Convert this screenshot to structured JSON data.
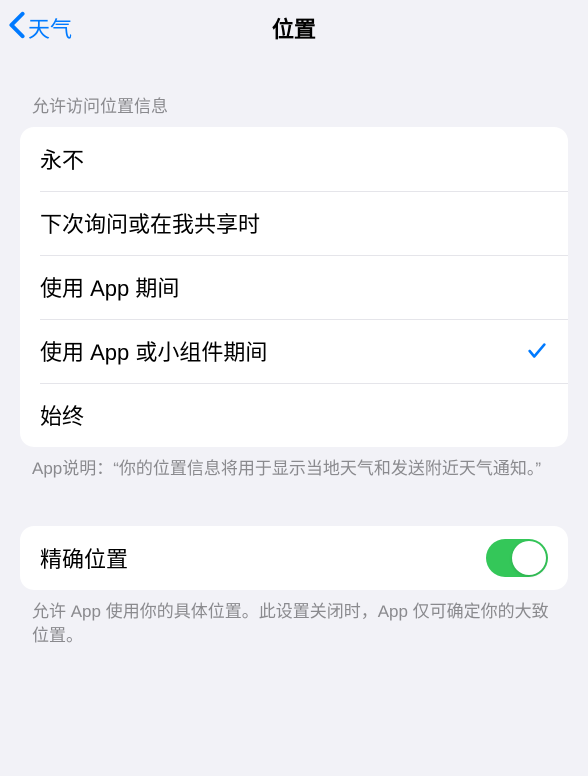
{
  "nav": {
    "back_label": "天气",
    "title": "位置"
  },
  "section1": {
    "header": "允许访问位置信息",
    "options": [
      {
        "label": "永不",
        "selected": false
      },
      {
        "label": "下次询问或在我共享时",
        "selected": false
      },
      {
        "label": "使用 App 期间",
        "selected": false
      },
      {
        "label": "使用 App 或小组件期间",
        "selected": true
      },
      {
        "label": "始终",
        "selected": false
      }
    ],
    "footer": "App说明：“你的位置信息将用于显示当地天气和发送附近天气通知。”"
  },
  "section2": {
    "precise_label": "精确位置",
    "precise_on": true,
    "footer": "允许 App 使用你的具体位置。此设置关闭时，App 仅可确定你的大致位置。"
  },
  "colors": {
    "accent": "#007aff",
    "toggle_on": "#34c759"
  }
}
